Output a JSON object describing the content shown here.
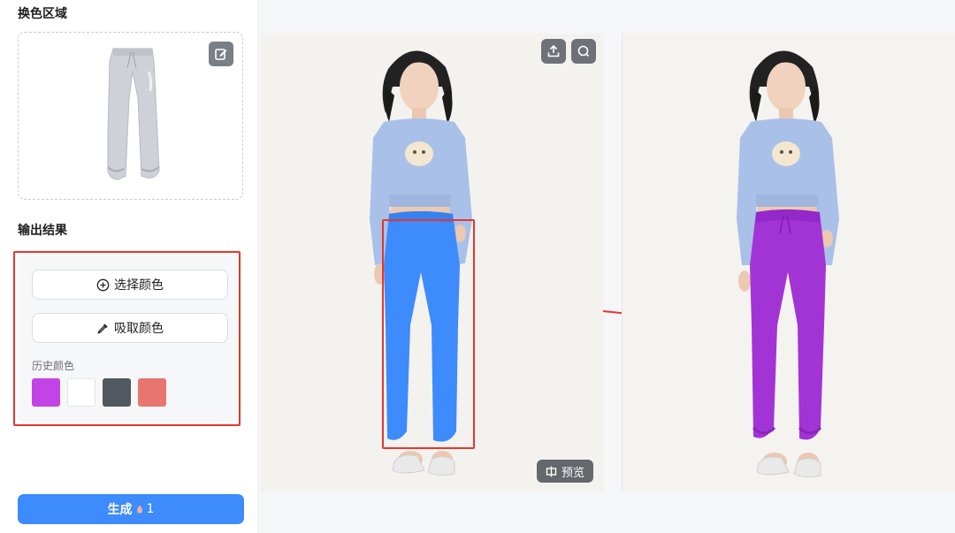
{
  "panel": {
    "region_title": "换色区域",
    "output_title": "输出结果",
    "select_color_label": "选择颜色",
    "pick_color_label": "吸取颜色",
    "history_label": "历史颜色",
    "history_colors": [
      "#c344e6",
      "#ffffff",
      "#525860",
      "#e8766f"
    ],
    "generate_label": "生成",
    "generate_cost": "1"
  },
  "canvas": {
    "preview_label": "预览",
    "original_pants_color": "#3d8bfd",
    "result_pants_color": "#a234d6",
    "highlight_color": "#e8362d"
  }
}
